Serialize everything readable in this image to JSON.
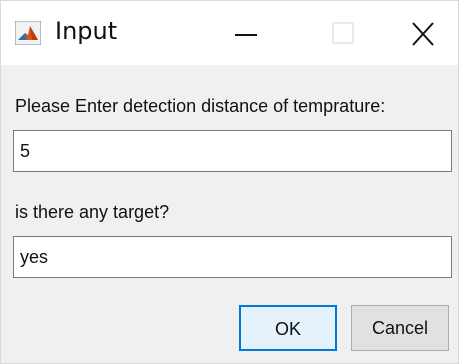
{
  "window": {
    "title": "Input",
    "app_icon": "matlab-icon",
    "controls": [
      "minimize-icon",
      "maximize-icon",
      "close-icon"
    ]
  },
  "prompts": [
    {
      "label": "Please Enter detection distance of temprature:",
      "value": "5"
    },
    {
      "label": "is there any target?",
      "value": "yes"
    }
  ],
  "buttons": {
    "ok_label": "OK",
    "cancel_label": "Cancel"
  },
  "colors": {
    "dialog_bg": "#f0f0f0",
    "focus_border": "#0078d7",
    "ok_bg": "#e5f1fb"
  }
}
